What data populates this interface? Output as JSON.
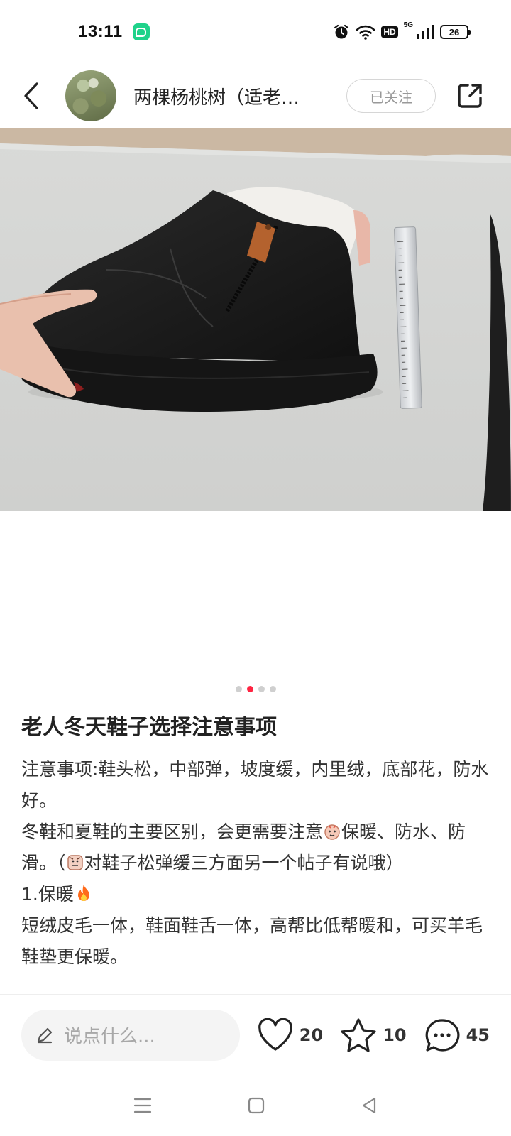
{
  "status_bar": {
    "time": "13:11",
    "network_type": "5G",
    "hd_label": "HD",
    "battery_level": "26"
  },
  "header": {
    "author_name": "两棵杨桃树（适老…",
    "follow_label": "已关注"
  },
  "carousel": {
    "total_images": 4,
    "active_index": 1
  },
  "post": {
    "title": "老人冬天鞋子选择注意事项",
    "line1": "注意事项:鞋头松，中部弹，坡度缓，内里绒，底部花，防水好。",
    "line2_before": "冬鞋和夏鞋的主要区别，会更需要注意",
    "line2_after": "保暖、防水、防滑。（",
    "line2_end": "对鞋子松弹缓三方面另一个帖子有说哦）",
    "section_heading": "1.保暖",
    "line3": "短绒皮毛一体，鞋面鞋舌一体，高帮比低帮暖和，可买羊毛鞋垫更保暖。"
  },
  "bottom_bar": {
    "comment_placeholder": "说点什么...",
    "like_count": "20",
    "collect_count": "10",
    "comment_count": "45"
  },
  "colors": {
    "accent": "#ff2442",
    "text": "#222222",
    "muted": "#a8a8a8"
  }
}
